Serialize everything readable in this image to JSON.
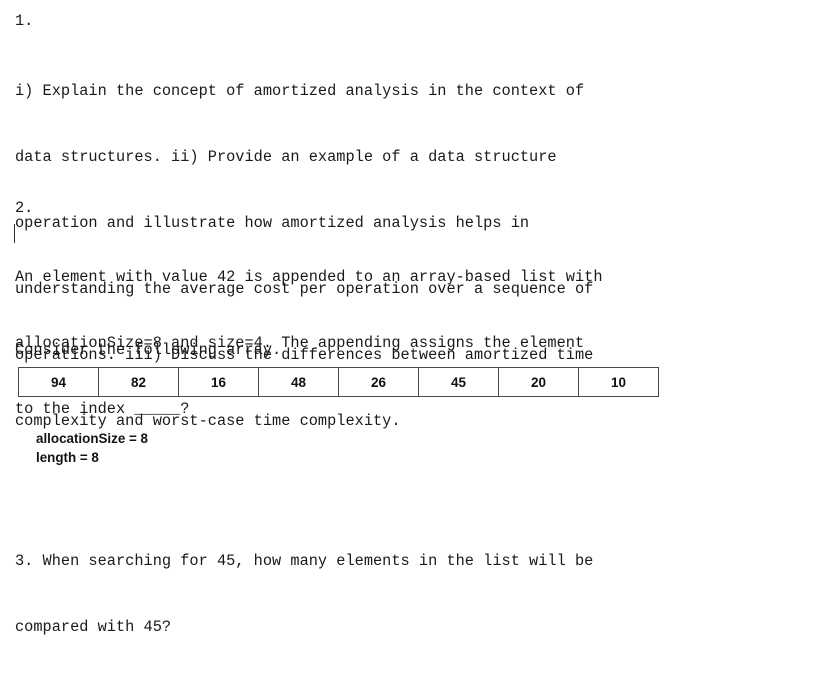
{
  "document": {
    "background_color": "#ffffff",
    "text_color": "#1a1a1a",
    "border_color": "#4a4a4a"
  },
  "question1": {
    "number": "1.",
    "lines": [
      "i) Explain the concept of amortized analysis in the context of",
      "data structures. ii) Provide an example of a data structure",
      "operation and illustrate how amortized analysis helps in",
      "understanding the average cost per operation over a sequence of",
      "operations. iii) Discuss the differences between amortized time",
      "complexity and worst-case time complexity."
    ]
  },
  "question2": {
    "number": "2.",
    "lines": [
      "An element with value 42 is appended to an array-based list with",
      "allocationSize=8 and size=4. The appending assigns the element",
      "to the index _____?"
    ]
  },
  "array_section": {
    "intro": "Consider the following array.",
    "cells": [
      "94",
      "82",
      "16",
      "48",
      "26",
      "45",
      "20",
      "10"
    ],
    "annotations": [
      "allocationSize = 8",
      "length = 8"
    ]
  },
  "question3": {
    "lines": [
      "3. When searching for 45, how many elements in the list will be",
      "compared with 45?"
    ]
  }
}
